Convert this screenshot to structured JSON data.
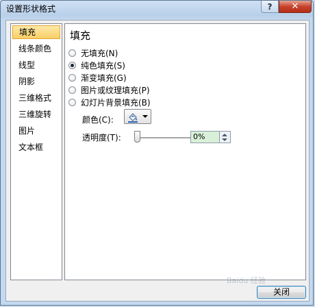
{
  "window": {
    "title": "设置形状格式",
    "help_label": "?",
    "close_label": "✕"
  },
  "sidebar": {
    "items": [
      {
        "label": "填充",
        "selected": true
      },
      {
        "label": "线条颜色",
        "selected": false
      },
      {
        "label": "线型",
        "selected": false
      },
      {
        "label": "阴影",
        "selected": false
      },
      {
        "label": "三维格式",
        "selected": false
      },
      {
        "label": "三维旋转",
        "selected": false
      },
      {
        "label": "图片",
        "selected": false
      },
      {
        "label": "文本框",
        "selected": false
      }
    ]
  },
  "fill": {
    "heading": "填充",
    "options": [
      {
        "label": "无填充(N)",
        "checked": false
      },
      {
        "label": "纯色填充(S)",
        "checked": true
      },
      {
        "label": "渐变填充(G)",
        "checked": false
      },
      {
        "label": "图片或纹理填充(P)",
        "checked": false
      },
      {
        "label": "幻灯片背景填充(B)",
        "checked": false
      }
    ],
    "color_label": "颜色(C):",
    "color_icon": "paint-bucket-icon",
    "transparency_label": "透明度(T):",
    "transparency_value": "0%",
    "transparency_fraction": 0
  },
  "footer": {
    "close_button_label": "关闭"
  },
  "watermark": "Baidu 经验",
  "colors": {
    "selected_item": "#f8cf66",
    "transparency_field": "#d8f0d8",
    "title_close": "#c7432d"
  }
}
